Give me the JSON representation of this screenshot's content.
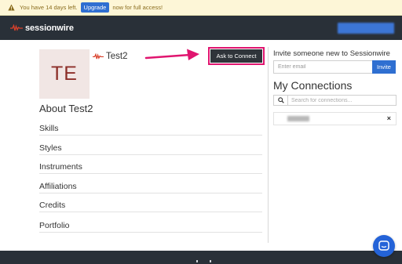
{
  "banner": {
    "text_before": "You have 14 days left.",
    "upgrade_label": "Upgrade",
    "text_after": "now for full access!",
    "icon": "warning-icon"
  },
  "header": {
    "brand": "sessionwire",
    "brand_icon": "waveform-icon"
  },
  "profile": {
    "initials": "TE",
    "name": "Test2",
    "connect_label": "Ask to Connect",
    "about_title": "About Test2",
    "sections": [
      "Skills",
      "Styles",
      "Instruments",
      "Affiliations",
      "Credits",
      "Portfolio"
    ]
  },
  "invite": {
    "title": "Invite someone new to Sessionwire",
    "placeholder": "Enter email",
    "button_label": "Invite"
  },
  "connections": {
    "title": "My Connections",
    "search_placeholder": "Search for connections...",
    "remove_symbol": "×"
  },
  "colors": {
    "accent": "#e0156f",
    "primary": "#2f6fd1",
    "header_bg": "#293038",
    "brand_red": "#d9412b"
  }
}
